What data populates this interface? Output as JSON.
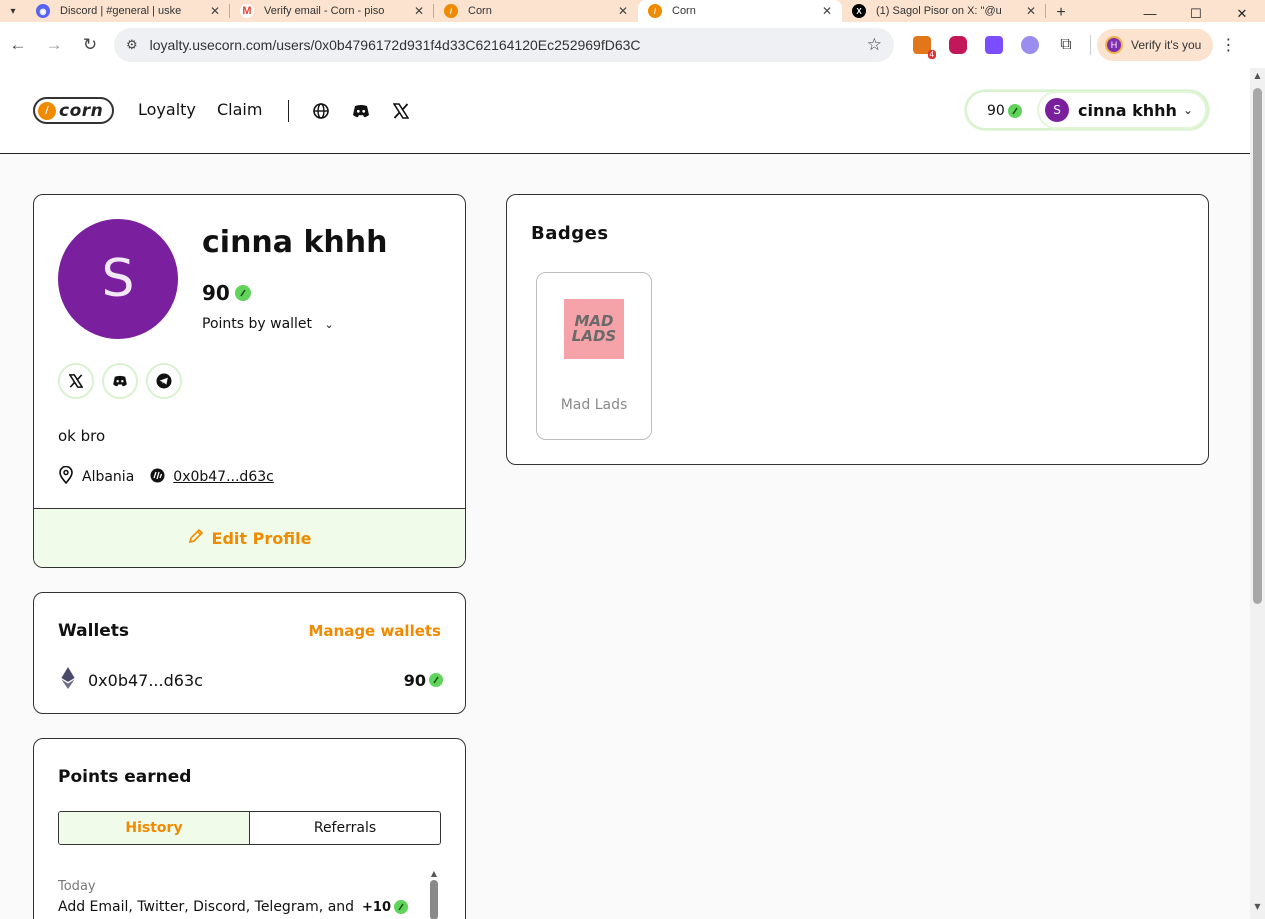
{
  "browser": {
    "tabs": [
      {
        "title": "Discord | #general | uske",
        "favicon_color": "#5865F2"
      },
      {
        "title": "Verify email - Corn - piso",
        "favicon_color": "#EA4335"
      },
      {
        "title": "Corn",
        "favicon_color": "#f08a00"
      },
      {
        "title": "Corn",
        "favicon_color": "#f08a00",
        "active": true
      },
      {
        "title": "(1) Sagol Pisor on X: \"@u",
        "favicon_color": "#000000"
      }
    ],
    "url": "loyalty.usecorn.com/users/0x0b4796172d931f4d33C62164120Ec252969fD63C",
    "extension_badge": "4",
    "verify_label": "Verify it's you",
    "profile_initial": "H"
  },
  "site": {
    "nav": {
      "loyalty": "Loyalty",
      "claim": "Claim"
    },
    "user_pill": {
      "points": "90",
      "initial": "S",
      "name": "cinna khhh"
    }
  },
  "profile": {
    "initial": "S",
    "name": "cinna khhh",
    "points": "90",
    "points_by_wallet": "Points by wallet",
    "bio": "ok bro",
    "location": "Albania",
    "address": "0x0b47...d63c",
    "edit_label": "Edit Profile"
  },
  "wallets": {
    "title": "Wallets",
    "manage_label": "Manage wallets",
    "items": [
      {
        "address": "0x0b47...d63c",
        "points": "90"
      }
    ]
  },
  "points_earned": {
    "title": "Points earned",
    "tabs": {
      "history": "History",
      "referrals": "Referrals"
    },
    "group_label": "Today",
    "entries": [
      {
        "text": "Add Email, Twitter, Discord, Telegram, and",
        "delta": "+10"
      }
    ]
  },
  "badges": {
    "title": "Badges",
    "items": [
      {
        "name": "Mad Lads",
        "logo_line1": "MAD",
        "logo_line2": "LADS"
      }
    ]
  },
  "colors": {
    "accent": "#f08a00",
    "avatar": "#7a1f9e",
    "points_leaf": "#5fd35a",
    "highlight_bg": "#f1fbe9"
  }
}
